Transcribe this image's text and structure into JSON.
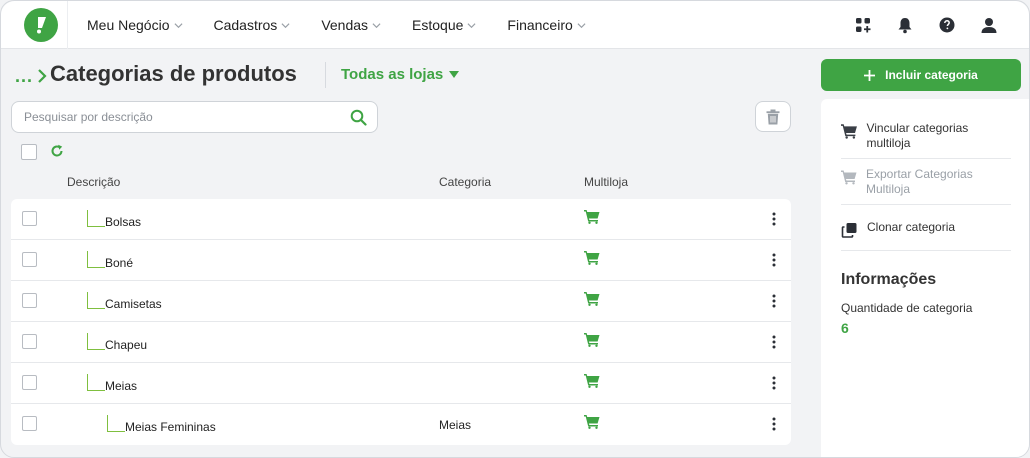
{
  "nav": {
    "items": [
      {
        "label": "Meu Negócio"
      },
      {
        "label": "Cadastros"
      },
      {
        "label": "Vendas"
      },
      {
        "label": "Estoque"
      },
      {
        "label": "Financeiro"
      }
    ],
    "icons": [
      "apps-add-icon",
      "bell-icon",
      "help-icon",
      "user-icon"
    ]
  },
  "header": {
    "breadcrumb": "...",
    "title": "Categorias de produtos",
    "store_select": "Todas as lojas"
  },
  "search": {
    "placeholder": "Pesquisar por descrição",
    "value": ""
  },
  "table": {
    "columns": {
      "description": "Descrição",
      "category": "Categoria",
      "multistore": "Multiloja"
    },
    "rows": [
      {
        "description": "Bolsas",
        "category": "",
        "level": 1,
        "multistore": true
      },
      {
        "description": "Boné",
        "category": "",
        "level": 1,
        "multistore": true
      },
      {
        "description": "Camisetas",
        "category": "",
        "level": 1,
        "multistore": true
      },
      {
        "description": "Chapeu",
        "category": "",
        "level": 1,
        "multistore": true
      },
      {
        "description": "Meias",
        "category": "",
        "level": 1,
        "multistore": true
      },
      {
        "description": "Meias Femininas",
        "category": "Meias",
        "level": 2,
        "multistore": true
      }
    ]
  },
  "side": {
    "add_button": "Incluir categoria",
    "actions": [
      {
        "label": "Vincular categorias multiloja",
        "disabled": false
      },
      {
        "label": "Exportar Categorias Multiloja",
        "disabled": true
      },
      {
        "label": "Clonar categoria",
        "disabled": false
      }
    ],
    "info": {
      "title": "Informações",
      "count_label": "Quantidade de categoria",
      "count_value": "6"
    }
  },
  "colors": {
    "brand": "#3fa444",
    "tree_line": "#7fbf3f",
    "text": "#333333",
    "muted": "#9aa0a7"
  }
}
